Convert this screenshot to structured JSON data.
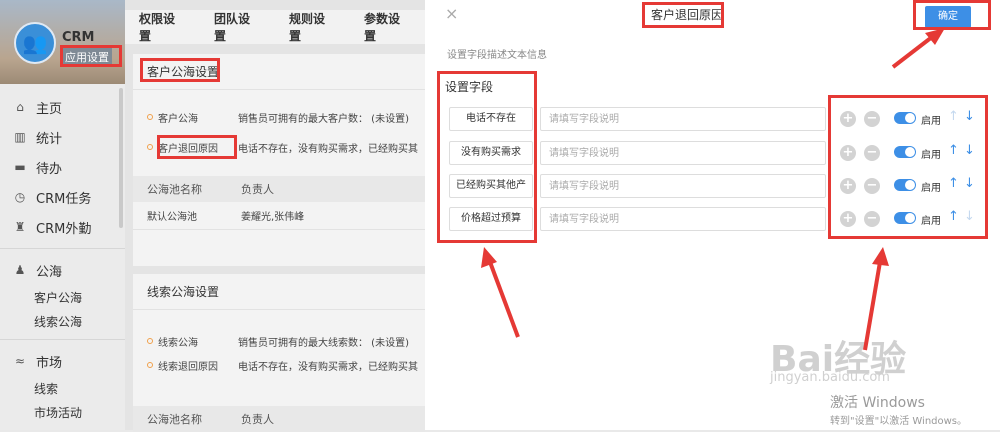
{
  "sidebar": {
    "brand": "CRM",
    "app_settings": "应用设置",
    "items": [
      {
        "icon": "home-icon",
        "glyph": "⌂",
        "label": "主页"
      },
      {
        "icon": "chart-icon",
        "glyph": "▥",
        "label": "统计"
      },
      {
        "icon": "todo-icon",
        "glyph": "▬",
        "label": "待办"
      },
      {
        "icon": "clock-icon",
        "glyph": "◷",
        "label": "CRM任务"
      },
      {
        "icon": "user-pin-icon",
        "glyph": "♜",
        "label": "CRM外勤"
      }
    ],
    "sea": {
      "label": "公海",
      "glyph": "♟",
      "icon": "sea-icon",
      "subs": [
        "客户公海",
        "线索公海"
      ]
    },
    "market": {
      "label": "市场",
      "glyph": "≈",
      "icon": "market-icon",
      "subs": [
        "线索",
        "市场活动"
      ]
    }
  },
  "main": {
    "tabs": [
      "权限设置",
      "团队设置",
      "规则设置",
      "参数设置"
    ],
    "customer_panel": {
      "title": "客户公海设置",
      "rows": [
        {
          "name": "客户公海",
          "desc": "销售员可拥有的最大客户数：  (未设置)"
        },
        {
          "name": "客户退回原因",
          "desc": "电话不存在，没有购买需求，已经购买其"
        }
      ],
      "table": {
        "headers": [
          "公海池名称",
          "负责人"
        ],
        "rows": [
          [
            "默认公海池",
            "姜耀光,张伟峰"
          ]
        ]
      }
    },
    "lead_panel": {
      "title": "线索公海设置",
      "rows": [
        {
          "name": "线索公海",
          "desc": "销售员可拥有的最大线索数：  (未设置)"
        },
        {
          "name": "线索退回原因",
          "desc": "电话不存在，没有购买需求，已经购买其"
        }
      ],
      "table": {
        "headers": [
          "公海池名称",
          "负责人"
        ]
      }
    }
  },
  "modal": {
    "close": "×",
    "title": "客户退回原因",
    "ok": "确定",
    "desc": "设置字段描述文本信息",
    "field_label": "设置字段",
    "placeholder": "请填写字段说明",
    "enable_label": "启用",
    "add_glyph": "+",
    "remove_glyph": "−",
    "up_glyph": "↑",
    "down_glyph": "↓",
    "fields": [
      {
        "name": "电话不存在",
        "up_enabled": false,
        "down_enabled": true
      },
      {
        "name": "没有购买需求",
        "up_enabled": true,
        "down_enabled": true
      },
      {
        "name": "已经购买其他产",
        "up_enabled": true,
        "down_enabled": true
      },
      {
        "name": "价格超过预算",
        "up_enabled": true,
        "down_enabled": false
      }
    ]
  },
  "watermark": {
    "baidu": "Bai经验",
    "baidu_url": "jingyan.baidu.com",
    "windows": "激活 Windows",
    "windows_sub": "转到\"设置\"以激活 Windows。"
  },
  "colors": {
    "accent": "#3d8fe6",
    "annotation": "#e53935"
  }
}
